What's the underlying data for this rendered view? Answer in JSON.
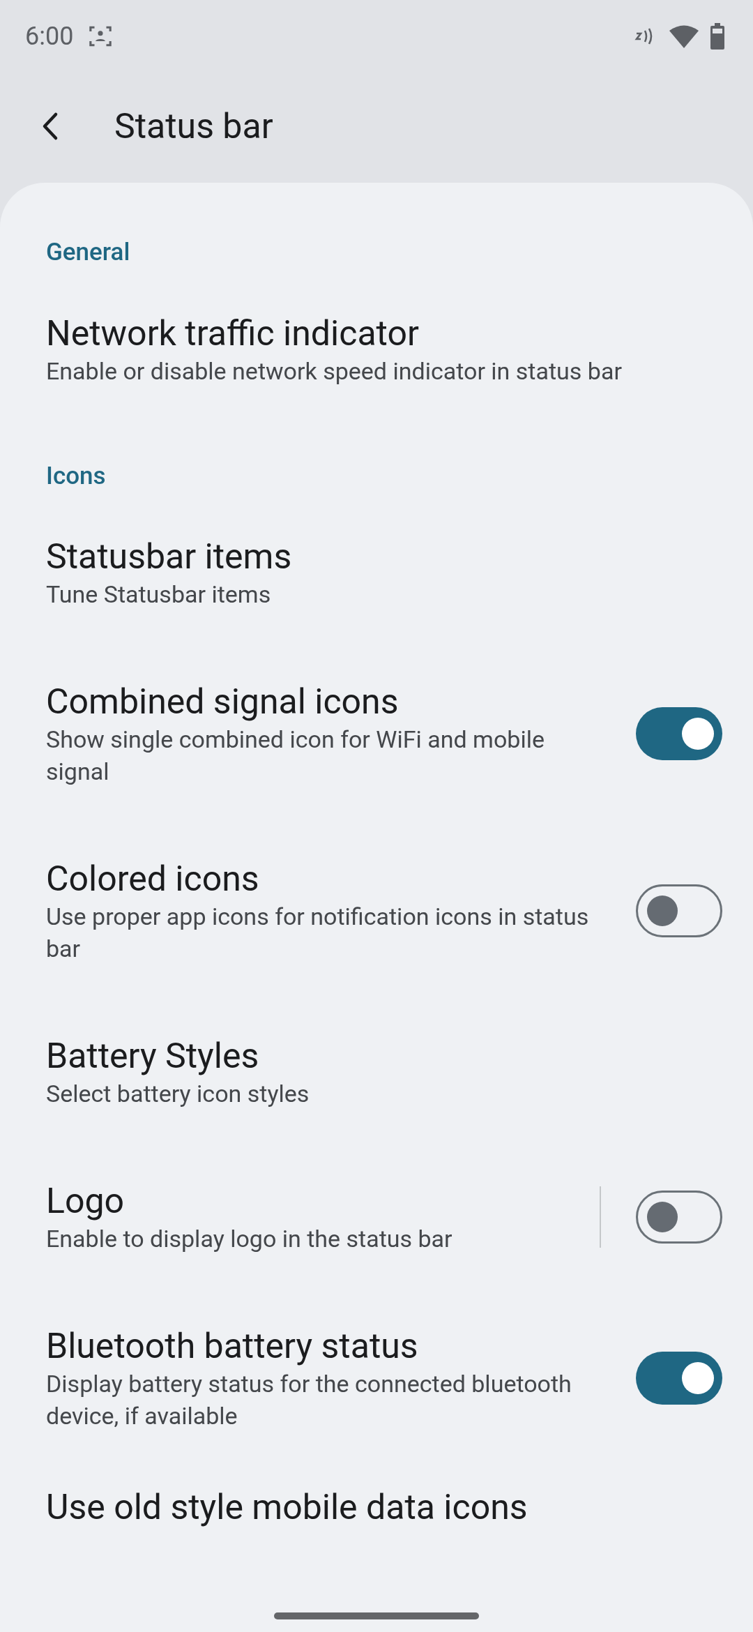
{
  "status_bar": {
    "time": "6:00"
  },
  "header": {
    "title": "Status bar"
  },
  "sections": [
    {
      "title": "General",
      "items": [
        {
          "kind": "plain",
          "title": "Network traffic indicator",
          "subtitle": "Enable or disable network speed indicator in status bar"
        }
      ]
    },
    {
      "title": "Icons",
      "items": [
        {
          "kind": "plain",
          "title": "Statusbar items",
          "subtitle": "Tune Statusbar items"
        },
        {
          "kind": "toggle",
          "title": "Combined signal icons",
          "subtitle": "Show single combined icon for WiFi and mobile signal",
          "on": true
        },
        {
          "kind": "toggle",
          "title": "Colored icons",
          "subtitle": "Use proper app icons for notification icons in status bar",
          "on": false
        },
        {
          "kind": "plain",
          "title": "Battery Styles",
          "subtitle": "Select battery icon styles"
        },
        {
          "kind": "split_toggle",
          "title": "Logo",
          "subtitle": "Enable to display logo in the status bar",
          "on": false
        },
        {
          "kind": "toggle",
          "title": "Bluetooth battery status",
          "subtitle": "Display battery status for the connected bluetooth device, if available",
          "on": true
        },
        {
          "kind": "title_only",
          "title": "Use old style mobile data icons"
        }
      ]
    }
  ]
}
